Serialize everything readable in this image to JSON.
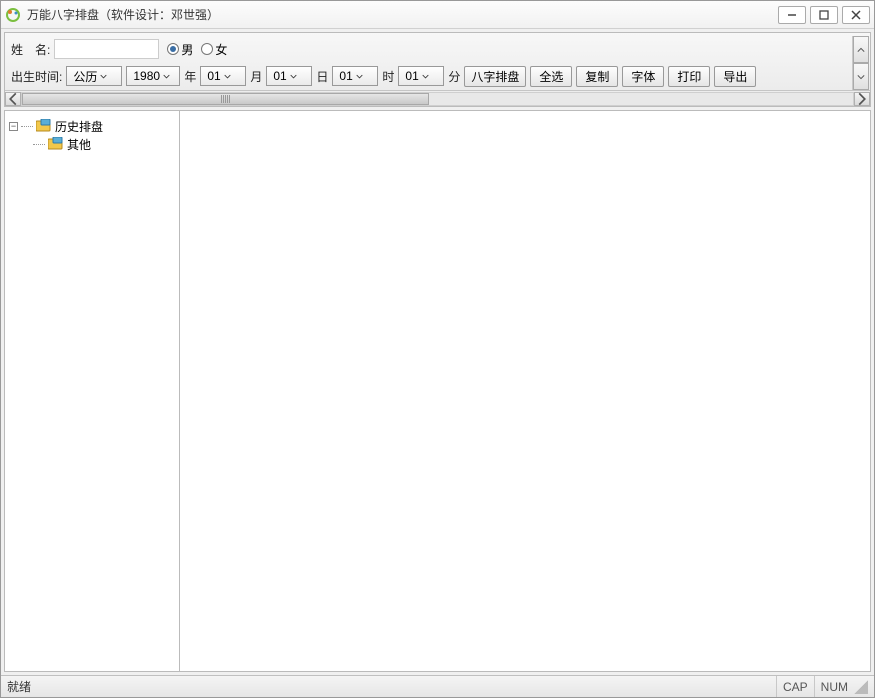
{
  "window": {
    "title": "万能八字排盘（软件设计：邓世强）"
  },
  "form": {
    "name_label": "姓　名:",
    "gender_male": "男",
    "gender_female": "女",
    "birth_label": "出生时间:",
    "calendar": "公历",
    "year": "1980",
    "year_unit": "年",
    "month": "01",
    "month_unit": "月",
    "day": "01",
    "day_unit": "日",
    "hour": "01",
    "hour_unit": "时",
    "minute": "01",
    "minute_unit": "分"
  },
  "buttons": {
    "paipan": "八字排盘",
    "select_all": "全选",
    "copy": "复制",
    "font": "字体",
    "print": "打印",
    "export": "导出"
  },
  "tree": {
    "root": "历史排盘",
    "child": "其他"
  },
  "status": {
    "ready": "就绪",
    "cap": "CAP",
    "num": "NUM"
  }
}
